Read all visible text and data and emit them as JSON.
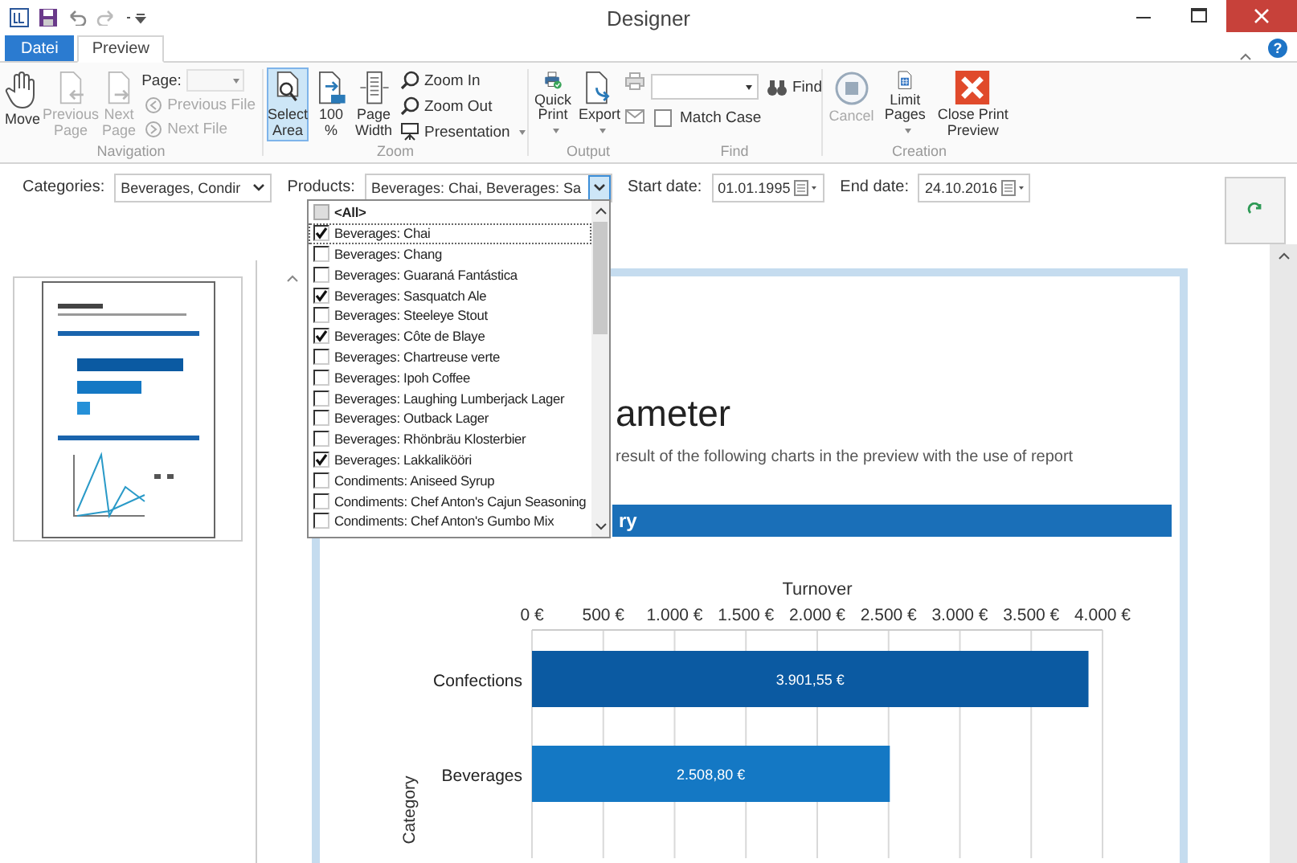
{
  "window": {
    "title": "Designer"
  },
  "tabs": [
    {
      "label": "Datei",
      "kind": "file",
      "selected": false
    },
    {
      "label": "Preview",
      "kind": "tab",
      "selected": true
    }
  ],
  "help": "?",
  "ribbon": {
    "navigation": {
      "label": "Navigation",
      "buttons": [
        {
          "label": "Move",
          "disabled": false
        },
        {
          "label": "Previous Page",
          "disabled": true
        },
        {
          "label": "Next Page",
          "disabled": true
        }
      ],
      "page_label": "Page:",
      "small_buttons": [
        {
          "label": "Previous File",
          "disabled": true
        },
        {
          "label": "Next File",
          "disabled": true
        }
      ]
    },
    "zoom": {
      "label": "Zoom",
      "buttons": [
        {
          "label": "Select Area",
          "selected": true
        },
        {
          "label": "100 %",
          "selected": false
        },
        {
          "label": "Page Width",
          "selected": false
        }
      ],
      "small_buttons": [
        {
          "label": "Zoom In",
          "dropdown": false
        },
        {
          "label": "Zoom Out",
          "dropdown": false
        },
        {
          "label": "Presentation",
          "dropdown": true
        }
      ]
    },
    "output": {
      "label": "Output",
      "buttons": [
        {
          "label": "Quick Print",
          "dropdown": true
        },
        {
          "label": "Export",
          "dropdown": true
        }
      ]
    },
    "find": {
      "label": "Find",
      "button": "Find",
      "match_case": {
        "label": "Match Case",
        "checked": false
      }
    },
    "creation": {
      "label": "Creation",
      "buttons": [
        {
          "label": "Cancel",
          "disabled": true,
          "dropdown": false
        },
        {
          "label": "Limit Pages",
          "disabled": false,
          "dropdown": true
        },
        {
          "label": "Close Print Preview",
          "disabled": false,
          "dropdown": false
        }
      ]
    }
  },
  "parameters": [
    {
      "label": "Categories:",
      "value": "Beverages, Condir",
      "kind": "combo",
      "open": false
    },
    {
      "label": "Products:",
      "value": "Beverages: Chai, Beverages: Sa",
      "kind": "combo",
      "open": true
    },
    {
      "label": "Start date:",
      "value": "01.01.1995",
      "kind": "date",
      "open": false
    },
    {
      "label": "End date:",
      "value": "24.10.2016",
      "kind": "date",
      "open": false
    }
  ],
  "product_list": [
    {
      "label": "<All>",
      "kind": "all",
      "checked": false,
      "selected": false
    },
    {
      "label": "Beverages: Chai",
      "kind": "item",
      "checked": true,
      "selected": true
    },
    {
      "label": "Beverages: Chang",
      "kind": "item",
      "checked": false,
      "selected": false
    },
    {
      "label": "Beverages: Guaraná Fantástica",
      "kind": "item",
      "checked": false,
      "selected": false
    },
    {
      "label": "Beverages: Sasquatch Ale",
      "kind": "item",
      "checked": true,
      "selected": false
    },
    {
      "label": "Beverages: Steeleye Stout",
      "kind": "item",
      "checked": false,
      "selected": false
    },
    {
      "label": "Beverages: Côte de Blaye",
      "kind": "item",
      "checked": true,
      "selected": false
    },
    {
      "label": "Beverages: Chartreuse verte",
      "kind": "item",
      "checked": false,
      "selected": false
    },
    {
      "label": "Beverages: Ipoh Coffee",
      "kind": "item",
      "checked": false,
      "selected": false
    },
    {
      "label": "Beverages: Laughing Lumberjack Lager",
      "kind": "item",
      "checked": false,
      "selected": false
    },
    {
      "label": "Beverages: Outback Lager",
      "kind": "item",
      "checked": false,
      "selected": false
    },
    {
      "label": "Beverages: Rhönbräu Klosterbier",
      "kind": "item",
      "checked": false,
      "selected": false
    },
    {
      "label": "Beverages: Lakkalikööri",
      "kind": "item",
      "checked": true,
      "selected": false
    },
    {
      "label": "Condiments: Aniseed Syrup",
      "kind": "item",
      "checked": false,
      "selected": false
    },
    {
      "label": "Condiments: Chef Anton's Cajun Seasoning",
      "kind": "item",
      "checked": false,
      "selected": false
    },
    {
      "label": "Condiments: Chef Anton's Gumbo Mix",
      "kind": "item",
      "checked": false,
      "selected": false
    }
  ],
  "page": {
    "title": "ameter",
    "subtitle": "result of the following charts in the preview with the use of report",
    "section_bar": "ry",
    "chart_data": {
      "type": "bar",
      "orientation": "horizontal",
      "title": "Turnover",
      "ylabel": "Category",
      "categories": [
        "Confections",
        "Beverages"
      ],
      "values": [
        3901.55,
        2508.8
      ],
      "xlim": [
        0,
        4000
      ],
      "xticks": [
        {
          "value": 0,
          "label": "0 €"
        },
        {
          "value": 500,
          "label": "500 €"
        },
        {
          "value": 1000,
          "label": "1.000 €"
        },
        {
          "value": 1500,
          "label": "1.500 €"
        },
        {
          "value": 2000,
          "label": "2.000 €"
        },
        {
          "value": 2500,
          "label": "2.500 €"
        },
        {
          "value": 3000,
          "label": "3.000 €"
        },
        {
          "value": 3500,
          "label": "3.500 €"
        },
        {
          "value": 4000,
          "label": "4.000 €"
        }
      ],
      "grid": true,
      "data_labels": true,
      "value_labels": [
        "3.901,55 €",
        "2.508,80 €"
      ]
    }
  }
}
